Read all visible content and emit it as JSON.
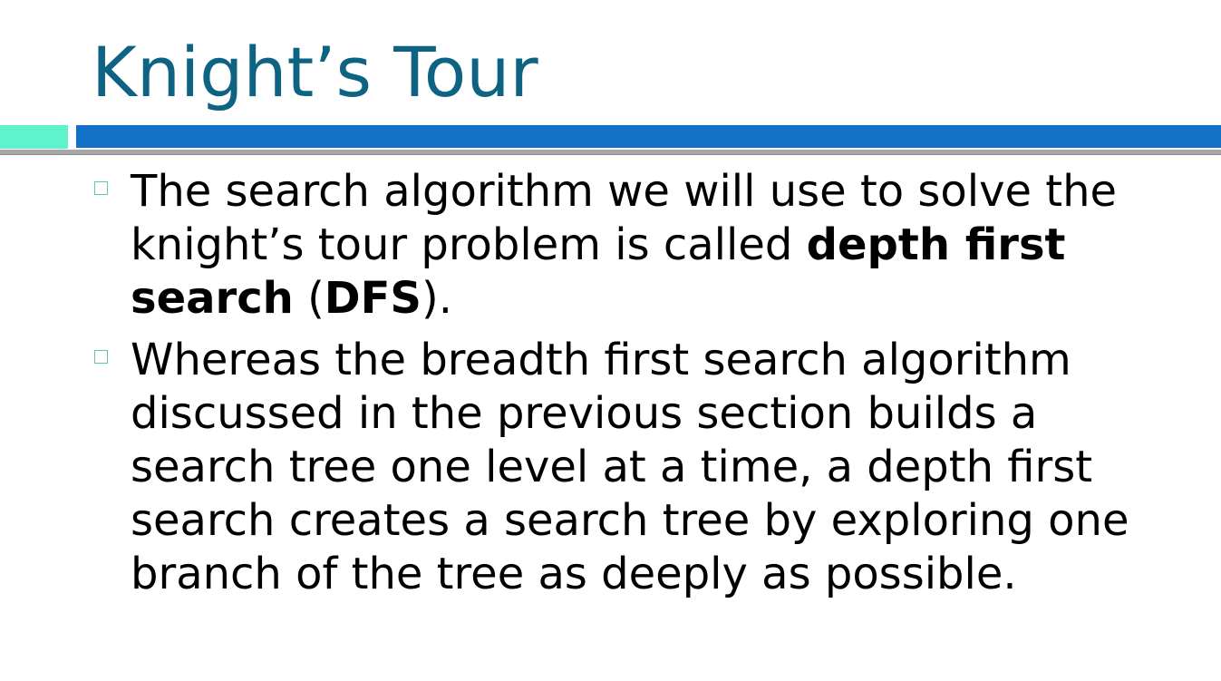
{
  "slide": {
    "title": "Knight’s Tour",
    "colors": {
      "title": "#0e6382",
      "accent_left": "#5ef2cd",
      "accent_right": "#1370c7",
      "divider": "#a7a7a7",
      "bullet_marker": "#5ec6b3"
    },
    "bullets": [
      {
        "marker_icon": "hollow-square-icon",
        "part1": "The search algorithm we will use to solve the knight’s tour problem is called ",
        "bold1": "depth first search",
        "part2": " (",
        "bold2": "DFS",
        "part3": ")."
      },
      {
        "marker_icon": "hollow-square-icon",
        "text": "Whereas the breadth first search algorithm discussed in the previous section builds a search tree one level at a time, a depth first search creates a search tree by exploring one branch of the tree as deeply as possible."
      }
    ]
  }
}
